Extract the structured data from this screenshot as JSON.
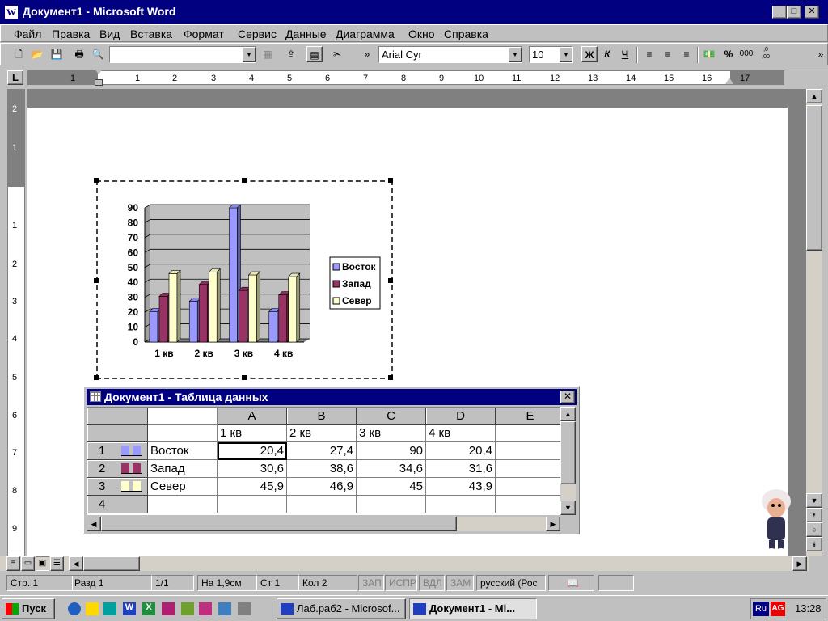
{
  "window": {
    "title": "Документ1 - Microsoft Word"
  },
  "menu": [
    "Файл",
    "Правка",
    "Вид",
    "Вставка",
    "Формат",
    "Сервис",
    "Данные",
    "Диаграмма",
    "Окно",
    "Справка"
  ],
  "toolbar": {
    "font_name": "Arial Cyr",
    "font_size": "10",
    "bold": "Ж",
    "italic": "К",
    "underline": "Ч",
    "percent": "%",
    "thousands": "000",
    "decimals": ",0\n,00"
  },
  "ruler": {
    "corner": "L",
    "numbers": [
      "1",
      "1",
      "2",
      "3",
      "4",
      "5",
      "6",
      "7",
      "8",
      "9",
      "10",
      "11",
      "12",
      "13",
      "14",
      "15",
      "16",
      "17"
    ],
    "vnumbers": [
      "2",
      "1",
      "1",
      "2",
      "3",
      "4",
      "5",
      "6",
      "7",
      "8",
      "9"
    ]
  },
  "chart_data": {
    "type": "bar",
    "categories": [
      "1 кв",
      "2 кв",
      "3 кв",
      "4 кв"
    ],
    "series": [
      {
        "name": "Восток",
        "values": [
          20.4,
          27.4,
          90,
          20.4
        ],
        "color": "#9999ff"
      },
      {
        "name": "Запад",
        "values": [
          30.6,
          38.6,
          34.6,
          31.6
        ],
        "color": "#993366"
      },
      {
        "name": "Север",
        "values": [
          45.9,
          46.9,
          45,
          43.9
        ],
        "color": "#ffffcc"
      }
    ],
    "ylim": [
      0,
      90
    ],
    "yticks": [
      "0",
      "10",
      "20",
      "30",
      "40",
      "50",
      "60",
      "70",
      "80",
      "90"
    ],
    "grid": true,
    "legend_position": "right",
    "background": "#c0c0c0"
  },
  "datasheet": {
    "title": "Документ1 - Таблица данных",
    "columns": [
      "A",
      "B",
      "C",
      "D",
      "E"
    ],
    "header_row": [
      "1 кв",
      "2 кв",
      "3 кв",
      "4 кв"
    ],
    "rows": [
      {
        "num": "1",
        "name": "Восток",
        "values": [
          "20,4",
          "27,4",
          "90",
          "20,4"
        ],
        "color": "#9999ff"
      },
      {
        "num": "2",
        "name": "Запад",
        "values": [
          "30,6",
          "38,6",
          "34,6",
          "31,6"
        ],
        "color": "#993366"
      },
      {
        "num": "3",
        "name": "Север",
        "values": [
          "45,9",
          "46,9",
          "45",
          "43,9"
        ],
        "color": "#ffffcc"
      },
      {
        "num": "4",
        "name": "",
        "values": [
          "",
          "",
          "",
          ""
        ],
        "color": ""
      }
    ]
  },
  "status": {
    "page": "Стр. 1",
    "section": "Разд 1",
    "pages": "1/1",
    "at": "На 1,9см",
    "line": "Ст 1",
    "col": "Кол 2",
    "rec": "ЗАП",
    "trk": "ИСПР",
    "ext": "ВДЛ",
    "ovr": "ЗАМ",
    "lang": "русский (Рос"
  },
  "taskbar": {
    "start": "Пуск",
    "task1": "Лаб.раб2 - Microsof...",
    "task2": "Документ1 - Mi...",
    "lang": "Ru",
    "clock": "13:28"
  }
}
